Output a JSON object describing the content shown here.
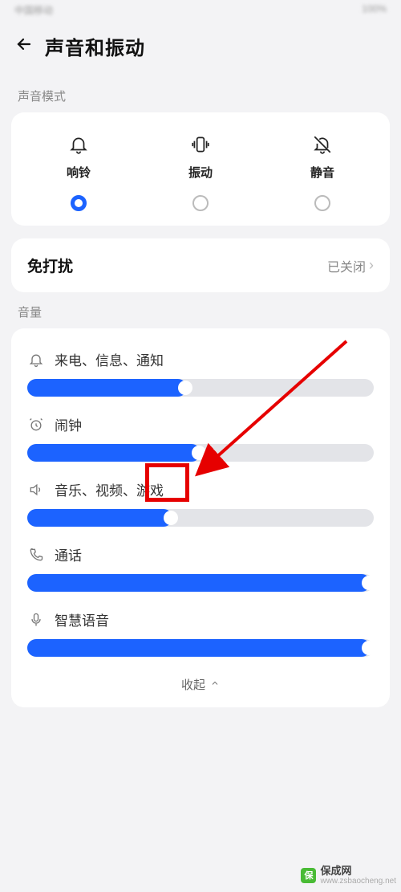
{
  "status": {
    "left": "中国移动",
    "right": "100%"
  },
  "header": {
    "title": "声音和振动"
  },
  "sound_mode": {
    "section": "声音模式",
    "items": [
      {
        "label": "响铃",
        "selected": true
      },
      {
        "label": "振动",
        "selected": false
      },
      {
        "label": "静音",
        "selected": false
      }
    ]
  },
  "dnd": {
    "title": "免打扰",
    "status": "已关闭"
  },
  "volume": {
    "section": "音量",
    "sliders": [
      {
        "label": "来电、信息、通知",
        "value": 46
      },
      {
        "label": "闹钟",
        "value": 50
      },
      {
        "label": "音乐、视频、游戏",
        "value": 42
      },
      {
        "label": "通话",
        "value": 99
      },
      {
        "label": "智慧语音",
        "value": 99
      }
    ],
    "collapse": "收起"
  },
  "watermark": {
    "brand": "保成网",
    "url": "www.zsbaocheng.net"
  }
}
